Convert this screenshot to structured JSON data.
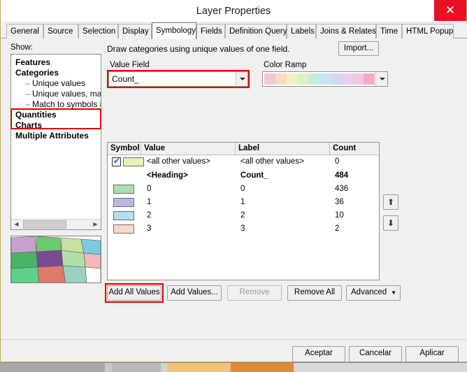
{
  "window": {
    "title": "Layer Properties",
    "close_icon": "close-icon",
    "close_label": "✕"
  },
  "tabs": [
    {
      "label": "General",
      "active": false
    },
    {
      "label": "Source",
      "active": false
    },
    {
      "label": "Selection",
      "active": false
    },
    {
      "label": "Display",
      "active": false
    },
    {
      "label": "Symbology",
      "active": true
    },
    {
      "label": "Fields",
      "active": false
    },
    {
      "label": "Definition Query",
      "active": false
    },
    {
      "label": "Labels",
      "active": false
    },
    {
      "label": "Joins & Relates",
      "active": false
    },
    {
      "label": "Time",
      "active": false
    },
    {
      "label": "HTML Popup",
      "active": false
    }
  ],
  "show": {
    "label": "Show:",
    "items": [
      {
        "label": "Features",
        "bold": true,
        "indent": 0
      },
      {
        "label": "Categories",
        "bold": true,
        "indent": 0
      },
      {
        "label": "Unique values",
        "bold": false,
        "indent": 1
      },
      {
        "label": "Unique values, many",
        "bold": false,
        "indent": 1
      },
      {
        "label": "Match to symbols in a",
        "bold": false,
        "indent": 1
      },
      {
        "label": "Quantities",
        "bold": true,
        "indent": 0
      },
      {
        "label": "Charts",
        "bold": true,
        "indent": 0
      },
      {
        "label": "Multiple Attributes",
        "bold": true,
        "indent": 0
      }
    ],
    "scroll_left_icon": "chevron-left-icon",
    "scroll_right_icon": "chevron-right-icon"
  },
  "main": {
    "description": "Draw categories using unique values of one field.",
    "import_label": "Import...",
    "value_field_label": "Value Field",
    "value_field_value": "Count_",
    "color_ramp_label": "Color Ramp",
    "color_ramp_colors": [
      "#f3c8cf",
      "#f7ddc0",
      "#f7f0c0",
      "#dff0c8",
      "#c8ead8",
      "#c8e4f0",
      "#d6d6f0",
      "#e6d0ee",
      "#f0c8e2",
      "#f7a8c8"
    ]
  },
  "table": {
    "headers": [
      "Symbol",
      "Value",
      "Label",
      "Count"
    ],
    "rows": [
      {
        "symbol_color": "#e8f0b8",
        "checkbox": true,
        "value": "<all other values>",
        "label": "<all other values>",
        "count": "0",
        "bold": false
      },
      {
        "symbol_color": "",
        "checkbox": false,
        "value": "<Heading>",
        "label": "Count_",
        "count": "484",
        "bold": true
      },
      {
        "symbol_color": "#a8e0b0",
        "checkbox": false,
        "value": "0",
        "label": "0",
        "count": "436",
        "bold": false
      },
      {
        "symbol_color": "#b8b8e8",
        "checkbox": false,
        "value": "1",
        "label": "1",
        "count": "36",
        "bold": false
      },
      {
        "symbol_color": "#b8dcf0",
        "checkbox": false,
        "value": "2",
        "label": "2",
        "count": "10",
        "bold": false
      },
      {
        "symbol_color": "#f6d8cc",
        "checkbox": false,
        "value": "3",
        "label": "3",
        "count": "2",
        "bold": false
      }
    ],
    "move_up_icon": "arrow-up-icon",
    "move_down_icon": "arrow-down-icon"
  },
  "buttons": {
    "add_all_values": "Add All Values",
    "add_values": "Add Values...",
    "remove": "Remove",
    "remove_all": "Remove All",
    "advanced": "Advanced",
    "advanced_arrow_icon": "chevron-down-icon"
  },
  "dialog_buttons": {
    "ok": "Aceptar",
    "cancel": "Cancelar",
    "apply": "Aplicar"
  },
  "highlights": {
    "accent_color": "#e00000",
    "regions": [
      "categories-unique-values",
      "value-field-combo",
      "add-all-values-button"
    ]
  }
}
